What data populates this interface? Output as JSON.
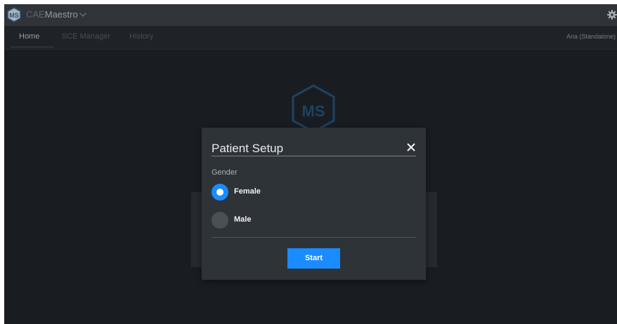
{
  "app": {
    "logo_text": "MS",
    "title_prefix": "CAE",
    "title_name": "Maestro"
  },
  "nav": {
    "tabs": [
      {
        "label": "Home",
        "active": true
      },
      {
        "label": "SCE Manager",
        "active": false
      },
      {
        "label": "History",
        "active": false
      }
    ],
    "user": "Aria (Standalone)"
  },
  "background": {
    "logo_text": "MS"
  },
  "modal": {
    "title": "Patient Setup",
    "close_icon": "close-icon",
    "gender_label": "Gender",
    "options": [
      {
        "label": "Female",
        "selected": true
      },
      {
        "label": "Male",
        "selected": false
      }
    ],
    "start_label": "Start"
  },
  "colors": {
    "accent": "#1a8cff",
    "topbar": "#3c4146",
    "background": "#1e2328",
    "modal": "#2e3338",
    "bg_logo": "#24557e"
  },
  "icons": {
    "app_logo": "ms-hexagon-logo",
    "app_menu": "chevron-down-icon",
    "settings": "gear-icon"
  }
}
